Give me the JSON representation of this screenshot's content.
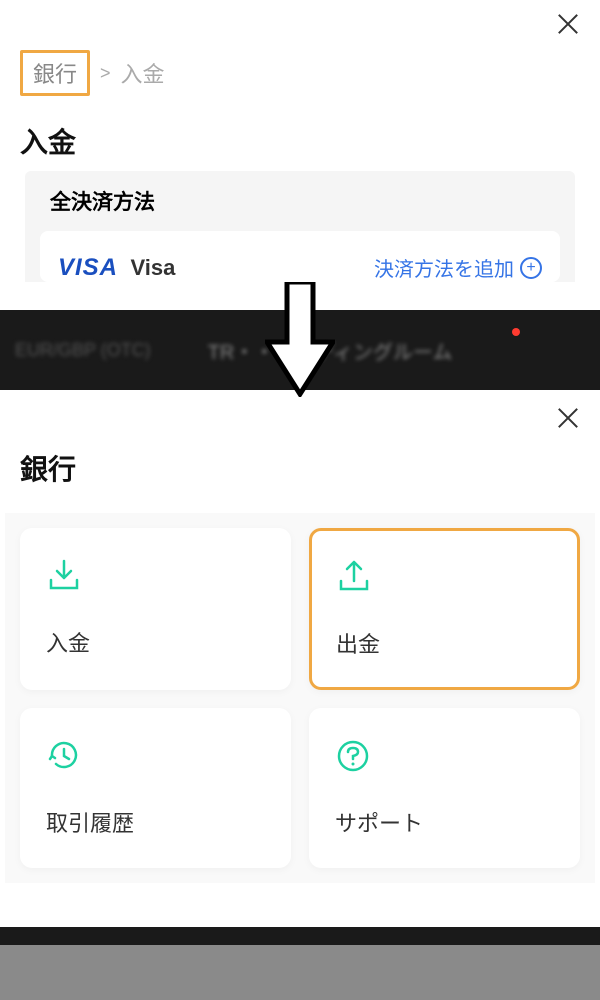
{
  "top": {
    "breadcrumb": {
      "item1": "銀行",
      "item2": "入金"
    },
    "title": "入金",
    "payment_header": "全決済方法",
    "visa_logo": "VISA",
    "visa_label": "Visa",
    "add_payment": "決済方法を追加"
  },
  "dark_bar": {
    "left_text": "EUR/GBP (OTC)",
    "center_text": "TR・・・ーディングルーム"
  },
  "bottom": {
    "title": "銀行",
    "tiles": {
      "deposit": "入金",
      "withdraw": "出金",
      "history": "取引履歴",
      "support": "サポート"
    }
  }
}
